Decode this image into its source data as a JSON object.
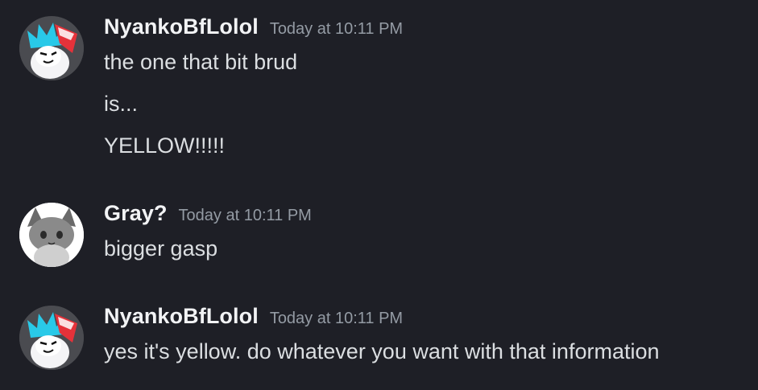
{
  "messages": [
    {
      "author": "NyankoBfLolol",
      "timestamp": "Today at 10:11 PM",
      "avatar_icon": "nyanko-bf-avatar-icon",
      "lines": [
        "the one that bit brud",
        "is...",
        "YELLOW!!!!!"
      ]
    },
    {
      "author": "Gray?",
      "timestamp": "Today at 10:11 PM",
      "avatar_icon": "gray-cat-avatar-icon",
      "lines": [
        "bigger gasp"
      ]
    },
    {
      "author": "NyankoBfLolol",
      "timestamp": "Today at 10:11 PM",
      "avatar_icon": "nyanko-bf-avatar-icon",
      "lines": [
        "yes it's yellow. do whatever you want with that information"
      ]
    }
  ],
  "colors": {
    "background": "#1e1f26",
    "username": "#f2f3f5",
    "timestamp": "#949ba4",
    "message_text": "#dbdee1"
  }
}
